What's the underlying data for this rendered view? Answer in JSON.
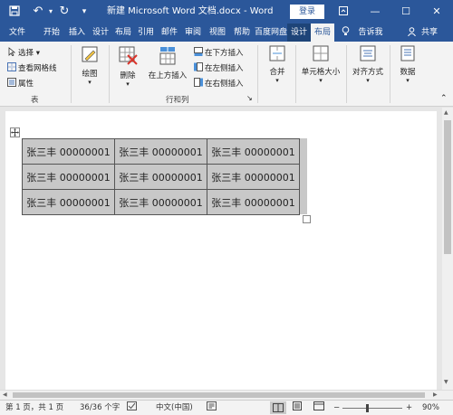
{
  "titlebar": {
    "save_icon": "save-icon",
    "undo_icon": "undo-icon",
    "redo_icon": "redo-icon",
    "customize_icon": "customize-quick-access-icon",
    "title": "新建 Microsoft Word 文档.docx - Word",
    "login": "登录",
    "ribbon_display_icon": "ribbon-display-options-icon",
    "minimize": "—",
    "maximize": "☐",
    "close": "✕"
  },
  "tabs": [
    "文件",
    "开始",
    "插入",
    "设计",
    "布局",
    "引用",
    "邮件",
    "审阅",
    "视图",
    "帮助",
    "百度网盘",
    "设计",
    "布局"
  ],
  "tell_me": "告诉我",
  "share": "共享",
  "ribbon": {
    "table_group": {
      "select": "选择",
      "gridlines": "查看网格线",
      "properties": "属性",
      "label": "表"
    },
    "draw": "绘图",
    "delete": "删除",
    "insert_above": "在上方插入",
    "insert_below": "在下方插入",
    "insert_left": "在左侧插入",
    "insert_right": "在右侧插入",
    "rows_cols_label": "行和列",
    "merge": "合并",
    "cell_size": "单元格大小",
    "alignment": "对齐方式",
    "data": "数据"
  },
  "table": {
    "rows": [
      [
        "张三丰 00000001",
        "张三丰 00000001",
        "张三丰 00000001"
      ],
      [
        "张三丰 00000001",
        "张三丰 00000001",
        "张三丰 00000001"
      ],
      [
        "张三丰 00000001",
        "张三丰 00000001",
        "张三丰 00000001"
      ]
    ]
  },
  "statusbar": {
    "page": "第 1 页，共 1 页",
    "words": "36/36 个字",
    "language": "中文(中国)",
    "zoom": "90%",
    "zoom_minus": "−",
    "zoom_plus": "+"
  },
  "colors": {
    "accent": "#2b579a",
    "table_fill": "#c8c8c8"
  }
}
